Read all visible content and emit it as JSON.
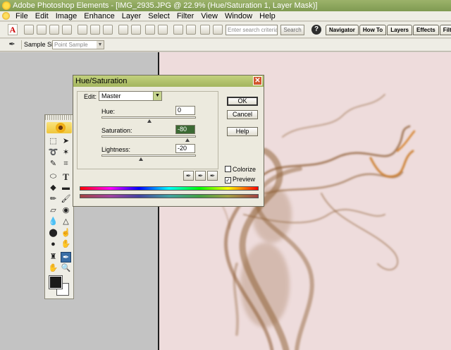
{
  "window": {
    "title": "Adobe Photoshop Elements - [IMG_2935.JPG @ 22.9% (Hue/Saturation 1, Layer Mask)]"
  },
  "menu": [
    "File",
    "Edit",
    "Image",
    "Enhance",
    "Layer",
    "Select",
    "Filter",
    "View",
    "Window",
    "Help"
  ],
  "toolbar": {
    "search_placeholder": "Enter search criteria",
    "search_button": "Search",
    "help_label": "?",
    "palette_tabs": [
      "Navigator",
      "How To",
      "Layers",
      "Effects",
      "Filters"
    ]
  },
  "options": {
    "sample_size_label": "Sample Size:",
    "sample_size_value": "Point Sample"
  },
  "dialog": {
    "title": "Hue/Saturation",
    "edit_label": "Edit:",
    "edit_value": "Master",
    "hue_label": "Hue:",
    "hue_value": "0",
    "saturation_label": "Saturation:",
    "saturation_value": "-80",
    "lightness_label": "Lightness:",
    "lightness_value": "-20",
    "ok_label": "OK",
    "cancel_label": "Cancel",
    "help_label": "Help",
    "colorize_label": "Colorize",
    "colorize_checked": false,
    "preview_label": "Preview",
    "preview_checked": true,
    "slider_levels": {
      "hue": 0,
      "saturation": -80,
      "lightness": -20
    }
  },
  "colors": {
    "accent": "#a3b55e",
    "document_bg": "#eedcdc",
    "smoke": "#8a5a2e",
    "highlight": "#3c6a34"
  }
}
